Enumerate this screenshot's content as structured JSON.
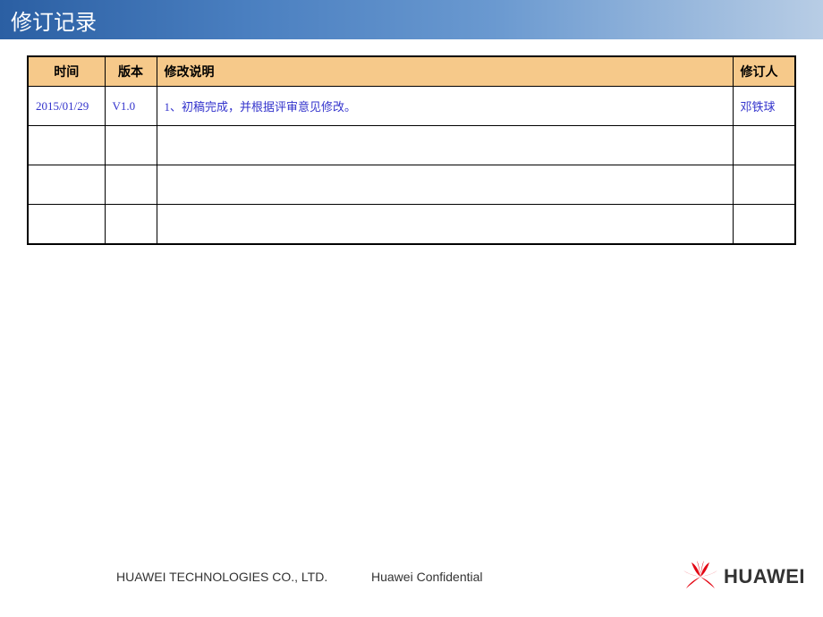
{
  "title": "修订记录",
  "table": {
    "headers": {
      "time": "时间",
      "version": "版本",
      "description": "修改说明",
      "author": "修订人"
    },
    "rows": [
      {
        "time": "2015/01/29",
        "version": "V1.0",
        "description": "1、初稿完成，并根据评审意见修改。",
        "author": "邓铁球"
      },
      {
        "time": "",
        "version": "",
        "description": "",
        "author": ""
      },
      {
        "time": "",
        "version": "",
        "description": "",
        "author": ""
      },
      {
        "time": "",
        "version": "",
        "description": "",
        "author": ""
      }
    ]
  },
  "footer": {
    "company": "HUAWEI TECHNOLOGIES CO., LTD.",
    "confidential": "Huawei Confidential",
    "logo_text": "HUAWEI"
  }
}
